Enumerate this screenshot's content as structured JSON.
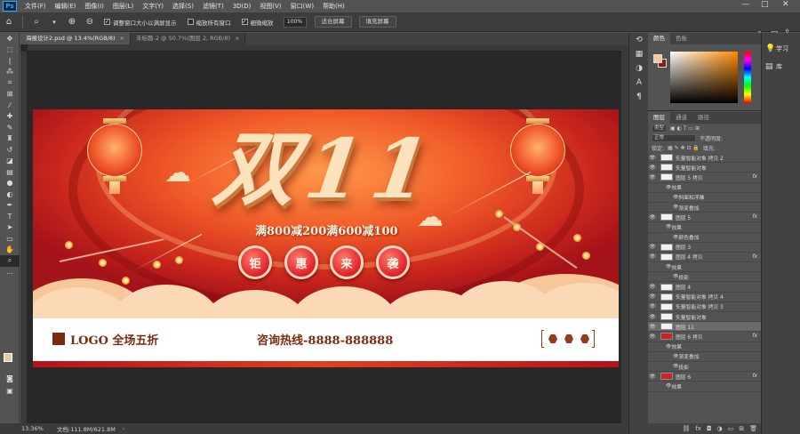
{
  "menubar": {
    "logo": "Ps",
    "items": [
      "文件(F)",
      "编辑(E)",
      "图像(I)",
      "图层(L)",
      "文字(Y)",
      "选择(S)",
      "滤镜(T)",
      "3D(D)",
      "视图(V)",
      "窗口(W)",
      "帮助(H)"
    ],
    "window_controls": [
      "—",
      "□",
      "✕"
    ]
  },
  "options": {
    "resize_windows_label": "调整窗口大小以满屏显示",
    "zoom_all_label": "缩放所有窗口",
    "scrubby_zoom_label": "细微缩放",
    "zoom_value": "100%",
    "fit_screen_label": "适合屏幕",
    "fill_screen_label": "填充屏幕"
  },
  "tabs": [
    {
      "label": "海报设计2.psd @ 13.4%(RGB/8)",
      "close": "×"
    },
    {
      "label": "未标题-2 @ 50.7%(图层 2, RGB/8)",
      "close": "×"
    }
  ],
  "artwork": {
    "title": "双11",
    "promo": "满800减200满600减100",
    "circles": [
      "钜",
      "惠",
      "来",
      "袭"
    ],
    "logo_text": "LOGO 全场五折",
    "hotline": "咨询热线-8888-888888"
  },
  "status": {
    "zoom": "13.36%",
    "doc": "文档:111.8M/621.8M",
    "arrow": "›"
  },
  "color_panel": {
    "tabs": [
      "颜色",
      "色板"
    ],
    "fg_color": "#f2c89e",
    "bg_color": "#8c1b1b"
  },
  "right_strip": {
    "learn": "学习",
    "library": "库"
  },
  "layers_panel": {
    "tabs": [
      "图层",
      "通道",
      "路径"
    ],
    "filter_kind": "类型",
    "blend_mode": "正常",
    "opacity_label": "不透明度:",
    "lock_label": "锁定:",
    "fill_label": "填充:",
    "layers": [
      {
        "name": "矢量智能对象 拷贝 2",
        "kind": "smart",
        "level": 0,
        "fx": false
      },
      {
        "name": "矢量智能对象",
        "kind": "smart",
        "level": 0,
        "fx": false
      },
      {
        "name": "图层 5 拷贝",
        "kind": "layer",
        "level": 0,
        "fx": true
      },
      {
        "name": "效果",
        "kind": "effect",
        "level": 1,
        "fx": false
      },
      {
        "name": "斜面和浮雕",
        "kind": "effect",
        "level": 2,
        "fx": false
      },
      {
        "name": "渐变叠加",
        "kind": "effect",
        "level": 2,
        "fx": false
      },
      {
        "name": "图层 5",
        "kind": "layer",
        "level": 0,
        "fx": true
      },
      {
        "name": "效果",
        "kind": "effect",
        "level": 1,
        "fx": false
      },
      {
        "name": "颜色叠加",
        "kind": "effect",
        "level": 2,
        "fx": false
      },
      {
        "name": "图层 3",
        "kind": "layer",
        "level": 0,
        "fx": false
      },
      {
        "name": "图层 4 拷贝",
        "kind": "layer",
        "level": 0,
        "fx": true
      },
      {
        "name": "效果",
        "kind": "effect",
        "level": 1,
        "fx": false
      },
      {
        "name": "投影",
        "kind": "effect",
        "level": 2,
        "fx": false
      },
      {
        "name": "图层 4",
        "kind": "layer",
        "level": 0,
        "fx": false
      },
      {
        "name": "矢量智能对象 拷贝 4",
        "kind": "smart",
        "level": 0,
        "fx": false
      },
      {
        "name": "矢量智能对象 拷贝 3",
        "kind": "smart",
        "level": 0,
        "fx": false
      },
      {
        "name": "矢量智能对象",
        "kind": "smart",
        "level": 0,
        "fx": false
      },
      {
        "name": "图层 11",
        "kind": "layer",
        "level": 0,
        "fx": false,
        "selected": true
      },
      {
        "name": "图层 6 拷贝",
        "kind": "red",
        "level": 0,
        "fx": true
      },
      {
        "name": "效果",
        "kind": "effect",
        "level": 1,
        "fx": false
      },
      {
        "name": "渐变叠加",
        "kind": "effect",
        "level": 2,
        "fx": false
      },
      {
        "name": "投影",
        "kind": "effect",
        "level": 2,
        "fx": false
      },
      {
        "name": "图层 6",
        "kind": "red",
        "level": 0,
        "fx": true
      },
      {
        "name": "效果",
        "kind": "effect",
        "level": 1,
        "fx": false
      }
    ],
    "bottom_icons": [
      "link-icon",
      "fx-icon",
      "mask-icon",
      "adjustment-icon",
      "folder-icon",
      "new-layer-icon",
      "trash-icon"
    ]
  }
}
